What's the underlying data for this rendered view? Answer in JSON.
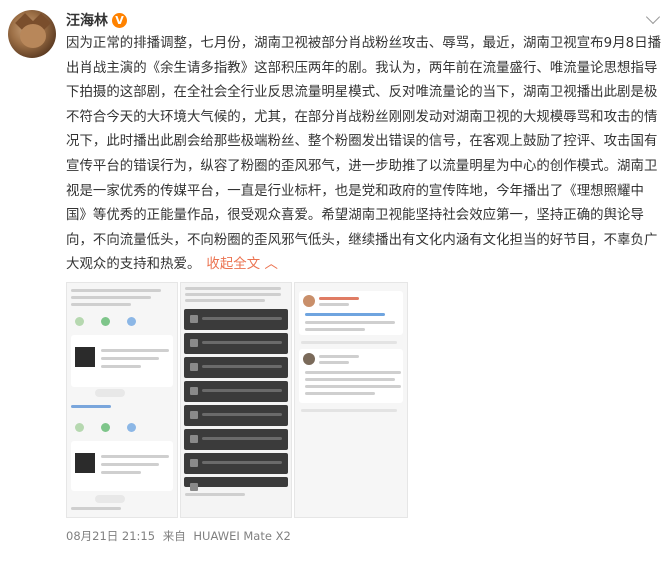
{
  "post": {
    "author": "汪海林",
    "verified_badge": "V",
    "body": "因为正常的排播调整，七月份，湖南卫视被部分肖战粉丝攻击、辱骂，最近，湖南卫视宣布9月8日播出肖战主演的《余生请多指教》这部积压两年的剧。我认为，两年前在流量盛行、唯流量论思想指导下拍摄的这部剧，在全社会全行业反思流量明星模式、反对唯流量论的当下，湖南卫视播出此剧是极不符合今天的大环境大气候的，尤其，在部分肖战粉丝刚刚发动对湖南卫视的大规模辱骂和攻击的情况下，此时播出此剧会给那些极端粉丝、整个粉圈发出错误的信号，在客观上鼓励了控评、攻击国有宣传平台的错误行为，纵容了粉圈的歪风邪气，进一步助推了以流量明星为中心的创作模式。湖南卫视是一家优秀的传媒平台，一直是行业标杆，也是党和政府的宣传阵地，今年播出了《理想照耀中国》等优秀的正能量作品，很受观众喜爱。希望湖南卫视能坚持社会效应第一，坚持正确的舆论导向，不向流量低头，不向粉圈的歪风邪气低头，继续播出有文化内涵有文化担当的好节目，不辜负广大观众的支持和热爱。",
    "collapse_label": "收起全文",
    "collapse_arrow": "︿",
    "timestamp": "08月21日 21:15",
    "source_prefix": "来自",
    "source_device": "HUAWEI Mate X2"
  },
  "icons": {
    "avatar": "avatar-cat",
    "verified": "verified-badge-icon",
    "more": "chevron-down-icon"
  },
  "colors": {
    "link": "#eb7350",
    "badge": "#ff8200",
    "text": "#333333",
    "meta": "#808080"
  }
}
